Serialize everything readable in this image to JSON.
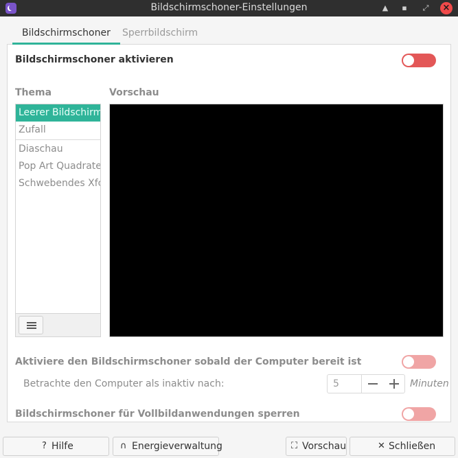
{
  "window": {
    "title": "Bildschirmschoner-Einstellungen",
    "icon": "screensaver-moon-icon",
    "controls": [
      "window-up-icon",
      "minimize-icon",
      "maximize-icon",
      "close-icon"
    ]
  },
  "tabs": [
    {
      "label": "Bildschirmschoner",
      "active": true
    },
    {
      "label": "Sperrbildschirm",
      "active": false
    }
  ],
  "screensaver": {
    "enable_label": "Bildschirmschoner aktivieren",
    "enabled": false
  },
  "theme": {
    "header": "Thema",
    "items": [
      "Leerer Bildschirm",
      "Zufall",
      "Diaschau",
      "Pop Art Quadrate",
      "Schwebendes Xfce"
    ],
    "selected": "Leerer Bildschirm"
  },
  "preview": {
    "header": "Vorschau"
  },
  "idle": {
    "activate_label": "Aktiviere den Bildschirmschoner sobald der Computer bereit ist",
    "activate_enabled": false,
    "inactive_label": "Betrachte den Computer als inaktiv nach:",
    "value": "5",
    "unit": "Minuten"
  },
  "fullscreen": {
    "label": "Bildschirmschoner für Vollbildanwendungen sperren",
    "enabled": false
  },
  "buttons": {
    "help": "Hilfe",
    "power": "Energieverwaltung",
    "preview": "Vorschau",
    "close": "Schließen"
  },
  "colors": {
    "accent": "#2fb499",
    "switch_off": "#e35757",
    "titlebar": "#2f2f2f"
  }
}
